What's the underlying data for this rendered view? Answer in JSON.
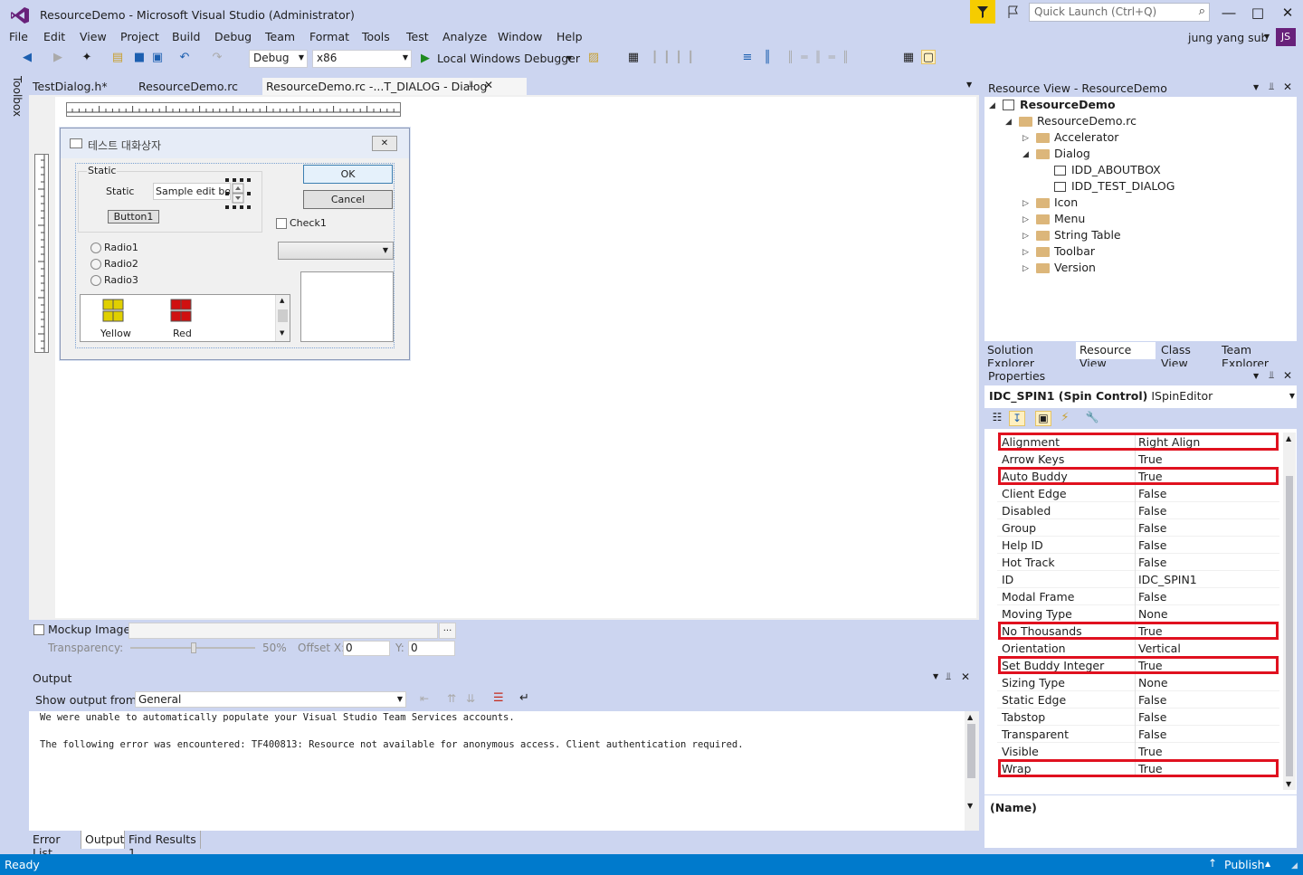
{
  "window": {
    "title": "ResourceDemo - Microsoft Visual Studio (Administrator)",
    "quick_launch_placeholder": "Quick Launch (Ctrl+Q)",
    "user_name": "jung yang sub",
    "user_initials": "JS",
    "accent": "#007acc"
  },
  "menu": [
    "File",
    "Edit",
    "View",
    "Project",
    "Build",
    "Debug",
    "Team",
    "Format",
    "Tools",
    "Test",
    "Analyze",
    "Window",
    "Help"
  ],
  "toolbar": {
    "config": "Debug",
    "platform": "x86",
    "debugger": "Local Windows Debugger"
  },
  "toolbox_label": "Toolbox",
  "doc_tabs": [
    "TestDialog.h*",
    "ResourceDemo.rc",
    "ResourceDemo.rc -...T_DIALOG - Dialog"
  ],
  "dialog": {
    "caption": "테스트 대화상자",
    "group_label": "Static",
    "static_label": "Static",
    "edit_value": "Sample edit box",
    "button1": "Button1",
    "ok": "OK",
    "cancel": "Cancel",
    "check1": "Check1",
    "radios": [
      "Radio1",
      "Radio2",
      "Radio3"
    ],
    "list_items": [
      "Yellow",
      "Red"
    ]
  },
  "mockup": {
    "label": "Mockup Image",
    "transparency_label": "Transparency:",
    "transparency_value": "50%",
    "offset_x_label": "Offset X:",
    "offset_x_value": "0",
    "y_label": "Y:",
    "y_value": "0",
    "browse": "..."
  },
  "output": {
    "title": "Output",
    "show_from_label": "Show output from:",
    "source": "General",
    "lines": [
      "We were unable to automatically populate your Visual Studio Team Services accounts.",
      "",
      "The following error was encountered: TF400813: Resource not available for anonymous access. Client authentication required."
    ]
  },
  "bottom_tabs": [
    "Error List",
    "Output",
    "Find Results 1"
  ],
  "status": {
    "left": "Ready",
    "publish": "Publish"
  },
  "resource_view": {
    "title": "Resource View - ResourceDemo",
    "root": "ResourceDemo",
    "rc": "ResourceDemo.rc",
    "folders_before": [
      "Accelerator"
    ],
    "dialog_folder": "Dialog",
    "dialogs": [
      "IDD_ABOUTBOX",
      "IDD_TEST_DIALOG"
    ],
    "folders_after": [
      "Icon",
      "Menu",
      "String Table",
      "Toolbar",
      "Version"
    ]
  },
  "side_tabs": [
    "Solution Explorer",
    "Resource View",
    "Class View",
    "Team Explorer"
  ],
  "properties": {
    "title": "Properties",
    "object": "IDC_SPIN1 (Spin Control)",
    "object_type": "ISpinEditor",
    "rows": [
      {
        "name": "Alignment",
        "value": "Right Align",
        "hl": true
      },
      {
        "name": "Arrow Keys",
        "value": "True",
        "hl": false
      },
      {
        "name": "Auto Buddy",
        "value": "True",
        "hl": true
      },
      {
        "name": "Client Edge",
        "value": "False",
        "hl": false
      },
      {
        "name": "Disabled",
        "value": "False",
        "hl": false
      },
      {
        "name": "Group",
        "value": "False",
        "hl": false
      },
      {
        "name": "Help ID",
        "value": "False",
        "hl": false
      },
      {
        "name": "Hot Track",
        "value": "False",
        "hl": false
      },
      {
        "name": "ID",
        "value": "IDC_SPIN1",
        "hl": false
      },
      {
        "name": "Modal Frame",
        "value": "False",
        "hl": false
      },
      {
        "name": "Moving Type",
        "value": "None",
        "hl": false
      },
      {
        "name": "No Thousands",
        "value": "True",
        "hl": true
      },
      {
        "name": "Orientation",
        "value": "Vertical",
        "hl": false
      },
      {
        "name": "Set Buddy Integer",
        "value": "True",
        "hl": true
      },
      {
        "name": "Sizing Type",
        "value": "None",
        "hl": false
      },
      {
        "name": "Static Edge",
        "value": "False",
        "hl": false
      },
      {
        "name": "Tabstop",
        "value": "False",
        "hl": false
      },
      {
        "name": "Transparent",
        "value": "False",
        "hl": false
      },
      {
        "name": "Visible",
        "value": "True",
        "hl": false
      },
      {
        "name": "Wrap",
        "value": "True",
        "hl": true
      }
    ],
    "desc_title": "(Name)"
  }
}
